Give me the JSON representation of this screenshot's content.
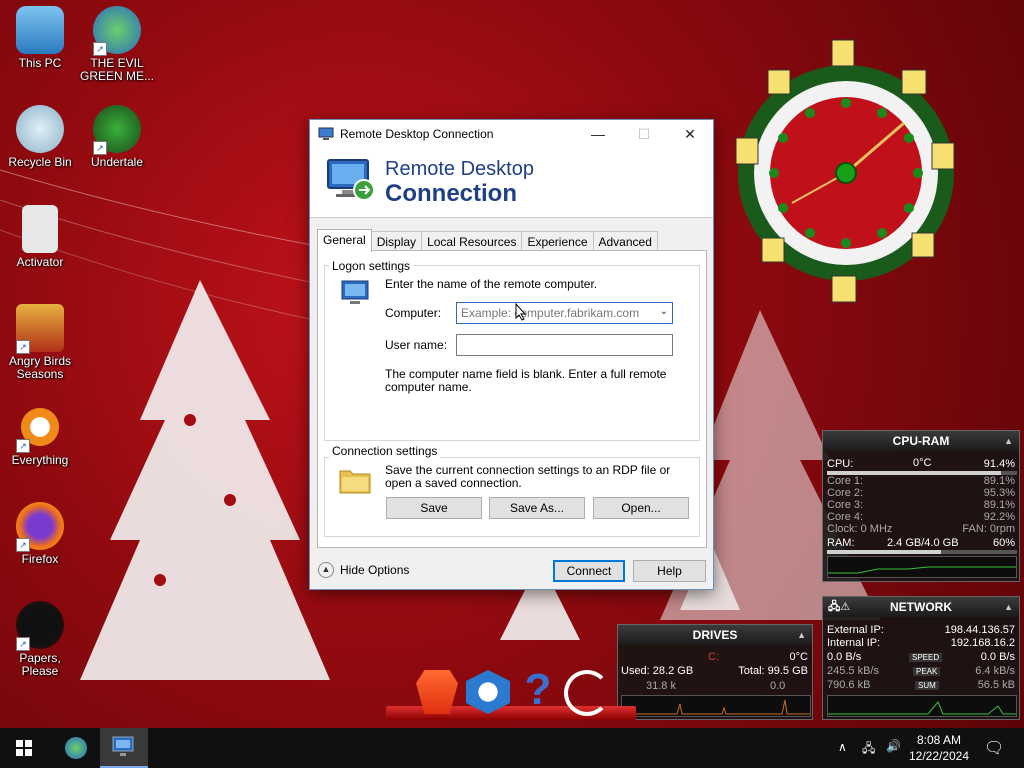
{
  "desktop": {
    "icons": [
      {
        "label": "This PC",
        "icon": "this-pc-icon"
      },
      {
        "label": "THE EVIL GREEN ME...",
        "icon": "msn-shortcut-icon"
      },
      {
        "label": "Recycle Bin",
        "icon": "recycle-bin-icon"
      },
      {
        "label": "Undertale",
        "icon": "undertale-icon"
      },
      {
        "label": "Activator",
        "icon": "activator-icon"
      },
      {
        "label": "Angry Birds Seasons",
        "icon": "angry-birds-icon"
      },
      {
        "label": "Everything",
        "icon": "everything-icon"
      },
      {
        "label": "Firefox",
        "icon": "firefox-icon"
      },
      {
        "label": "Papers, Please",
        "icon": "papers-please-icon"
      }
    ]
  },
  "rdp": {
    "title": "Remote Desktop Connection",
    "banner_line1": "Remote Desktop",
    "banner_line2": "Connection",
    "tabs": [
      "General",
      "Display",
      "Local Resources",
      "Experience",
      "Advanced"
    ],
    "active_tab": "General",
    "logon": {
      "group_label": "Logon settings",
      "instruction": "Enter the name of the remote computer.",
      "computer_label": "Computer:",
      "computer_placeholder": "Example: computer.fabrikam.com",
      "username_label": "User name:",
      "username_value": "",
      "warning": "The computer name field is blank. Enter a full remote computer name."
    },
    "connection": {
      "group_label": "Connection settings",
      "description": "Save the current connection settings to an RDP file or open a saved connection.",
      "save": "Save",
      "save_as": "Save As...",
      "open": "Open..."
    },
    "hide_options": "Hide Options",
    "connect": "Connect",
    "help": "Help"
  },
  "cpu_ram": {
    "title": "CPU-RAM",
    "cpu_label": "CPU:",
    "cpu_temp": "0°C",
    "cpu_pct": "91.4%",
    "cores": [
      {
        "label": "Core 1:",
        "value": "89.1%"
      },
      {
        "label": "Core 2:",
        "value": "95.3%"
      },
      {
        "label": "Core 3:",
        "value": "89.1%"
      },
      {
        "label": "Core 4:",
        "value": "92.2%"
      }
    ],
    "clock": "Clock: 0 MHz",
    "fan": "FAN: 0rpm",
    "ram_label": "RAM:",
    "ram_amount": "2.4 GB/4.0 GB",
    "ram_pct": "60%"
  },
  "network": {
    "title": "NETWORK",
    "external_label": "External IP:",
    "external_ip": "198.44.136.57",
    "internal_label": "Internal IP:",
    "internal_ip": "192.168.16.2",
    "speed_down": "0.0 B/s",
    "speed_label": "SPEED",
    "speed_up": "0.0 B/s",
    "peak_down": "245.5 kB/s",
    "peak_label": "PEAK",
    "peak_up": "6.4 kB/s",
    "sum_down": "790.6 kB",
    "sum_label": "SUM",
    "sum_up": "56.5 kB"
  },
  "drives": {
    "title": "DRIVES",
    "drive_letter": "C:",
    "temp": "0°C",
    "used": "Used: 28.2 GB",
    "total": "Total: 99.5 GB",
    "read": "31.8 k",
    "write": "0.0"
  },
  "taskbar": {
    "time": "8:08 AM",
    "date": "12/22/2024"
  },
  "colors": {
    "accent": "#0078d7",
    "banner_text": "#1f3f86"
  }
}
